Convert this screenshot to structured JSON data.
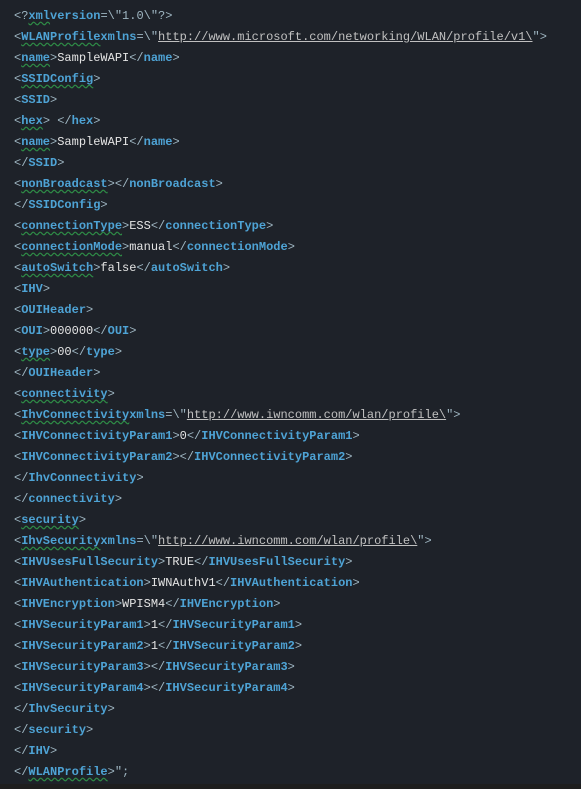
{
  "lines": {
    "l1": {
      "a": "<?",
      "b": "xml",
      "c": "version",
      "d": "=\\\"1.0\\\"?>"
    },
    "l2": {
      "a": "<",
      "b": "WLANProfile",
      "c": "xmlns",
      "d": "=\\\"",
      "e": "http://www.microsoft.com/networking/WLAN/profile/v1\\",
      "f": "\">"
    },
    "l3": {
      "a": "<",
      "b": "name",
      "c": ">",
      "d": "SampleWAPI",
      "e": "</",
      "f": "name",
      "g": ">"
    },
    "l4": {
      "a": "<",
      "b": "SSIDConfig",
      "c": ">"
    },
    "l5": {
      "a": "<",
      "b": "SSID",
      "c": ">"
    },
    "l6": {
      "a": "<",
      "b": "hex",
      "c": "> </",
      "d": "hex",
      "e": ">"
    },
    "l7": {
      "a": "<",
      "b": "name",
      "c": ">",
      "d": "SampleWAPI",
      "e": "</",
      "f": "name",
      "g": ">"
    },
    "l8": {
      "a": "</",
      "b": "SSID",
      "c": ">"
    },
    "l9": {
      "a": "<",
      "b": "nonBroadcast",
      "c": "></",
      "d": "nonBroadcast",
      "e": ">"
    },
    "l10": {
      "a": "</",
      "b": "SSIDConfig",
      "c": ">"
    },
    "l11": {
      "a": "<",
      "b": "connectionType",
      "c": ">",
      "d": "ESS",
      "e": "</",
      "f": "connectionType",
      "g": ">"
    },
    "l12": {
      "a": "<",
      "b": "connectionMode",
      "c": ">",
      "d": "manual",
      "e": "</",
      "f": "connectionMode",
      "g": ">"
    },
    "l13": {
      "a": "<",
      "b": "autoSwitch",
      "c": ">",
      "d": "false",
      "e": "</",
      "f": "autoSwitch",
      "g": ">"
    },
    "l14": {
      "a": "<",
      "b": "IHV",
      "c": ">"
    },
    "l15": {
      "a": "<",
      "b": "OUIHeader",
      "c": ">"
    },
    "l16": {
      "a": "<",
      "b": "OUI",
      "c": ">",
      "d": "000000",
      "e": "</",
      "f": "OUI",
      "g": ">"
    },
    "l17": {
      "a": "<",
      "b": "type",
      "c": ">",
      "d": "00",
      "e": "</",
      "f": "type",
      "g": ">"
    },
    "l18": {
      "a": "</",
      "b": "OUIHeader",
      "c": ">"
    },
    "l19": {
      "a": "<",
      "b": "connectivity",
      "c": ">"
    },
    "l20": {
      "a": "<",
      "b": "IhvConnectivity",
      "c": "xmlns",
      "d": "=\\\"",
      "e": "http://www.iwncomm.com/wlan/profile\\",
      "f": "\">"
    },
    "l21": {
      "a": "<",
      "b": "IHVConnectivityParam1",
      "c": ">",
      "d": "0",
      "e": "</",
      "f": "IHVConnectivityParam1",
      "g": ">"
    },
    "l22": {
      "a": "<",
      "b": "IHVConnectivityParam2",
      "c": "></",
      "d": "IHVConnectivityParam2",
      "e": ">"
    },
    "l23": {
      "a": "</",
      "b": "IhvConnectivity",
      "c": ">"
    },
    "l24": {
      "a": "</",
      "b": "connectivity",
      "c": ">"
    },
    "l25": {
      "a": "<",
      "b": "security",
      "c": ">"
    },
    "l26": {
      "a": "<",
      "b": "IhvSecurity",
      "c": "xmlns",
      "d": "=\\\"",
      "e": "http://www.iwncomm.com/wlan/profile\\",
      "f": "\">"
    },
    "l27": {
      "a": "<",
      "b": "IHVUsesFullSecurity",
      "c": ">",
      "d": "TRUE",
      "e": "</",
      "f": "IHVUsesFullSecurity",
      "g": ">"
    },
    "l28": {
      "a": "<",
      "b": "IHVAuthentication",
      "c": ">",
      "d": "IWNAuthV1",
      "e": "</",
      "f": "IHVAuthentication",
      "g": ">"
    },
    "l29": {
      "a": "<",
      "b": "IHVEncryption",
      "c": ">",
      "d": "WPISM4",
      "e": "</",
      "f": "IHVEncryption",
      "g": ">"
    },
    "l30": {
      "a": "<",
      "b": "IHVSecurityParam1",
      "c": ">",
      "d": "1",
      "e": "</",
      "f": "IHVSecurityParam1",
      "g": ">"
    },
    "l31": {
      "a": "<",
      "b": "IHVSecurityParam2",
      "c": ">",
      "d": "1",
      "e": "</",
      "f": "IHVSecurityParam2",
      "g": ">"
    },
    "l32": {
      "a": "<",
      "b": "IHVSecurityParam3",
      "c": "></",
      "d": "IHVSecurityParam3",
      "e": ">"
    },
    "l33": {
      "a": "<",
      "b": "IHVSecurityParam4",
      "c": "></",
      "d": "IHVSecurityParam4",
      "e": ">"
    },
    "l34": {
      "a": "</",
      "b": "IhvSecurity",
      "c": ">"
    },
    "l35": {
      "a": "</",
      "b": "security",
      "c": ">"
    },
    "l36": {
      "a": "</",
      "b": "IHV",
      "c": ">"
    },
    "l37": {
      "a": "</",
      "b": "WLANProfile",
      "c": ">\";"
    }
  }
}
